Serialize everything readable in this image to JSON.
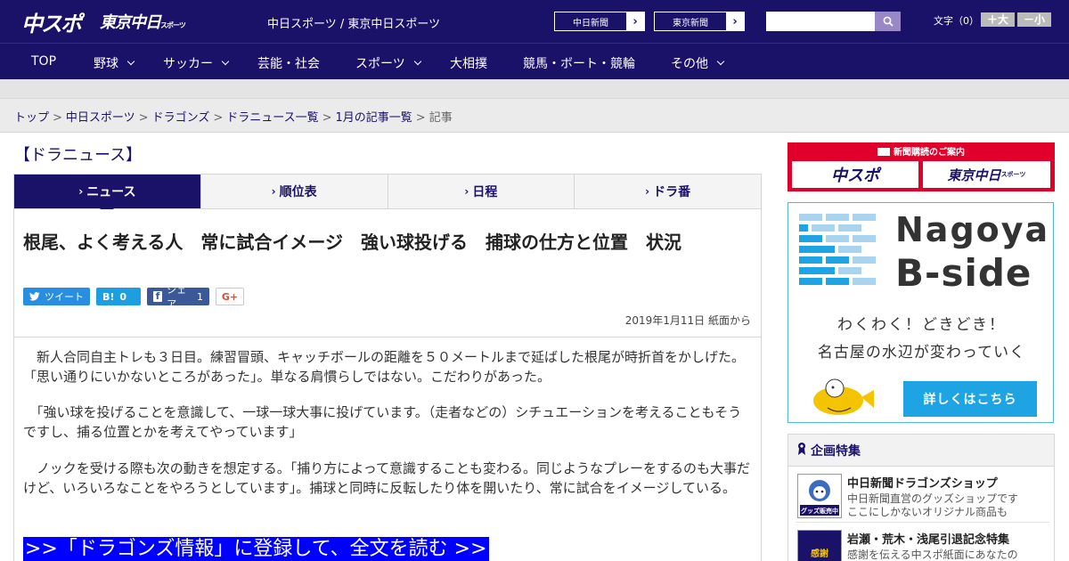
{
  "header": {
    "logo_left": "中スポ",
    "logo_right": "東京中日",
    "logo_right_small": "スポーツ",
    "site_title": "中日スポーツ / 東京中日スポーツ",
    "btn_chunichi": "中日新聞",
    "btn_tokyo": "東京新聞",
    "arrow": "›",
    "search_placeholder": "",
    "font_label": "文字（0）",
    "font_plus": "＋大",
    "font_minus": "－小"
  },
  "nav": [
    {
      "label": "TOP"
    },
    {
      "label": "野球"
    },
    {
      "label": "サッカー"
    },
    {
      "label": "芸能・社会"
    },
    {
      "label": "スポーツ"
    },
    {
      "label": "大相撲"
    },
    {
      "label": "競馬・ボート・競輪"
    },
    {
      "label": "その他"
    }
  ],
  "breadcrumb": {
    "items": [
      "トップ",
      "中日スポーツ",
      "ドラゴンズ",
      "ドラニュース一覧",
      "1月の記事一覧"
    ],
    "current": "記事",
    "sep": ">"
  },
  "section_title": "【ドラニュース】",
  "tabs": [
    {
      "label": "ニュース"
    },
    {
      "label": "順位表"
    },
    {
      "label": "日程"
    },
    {
      "label": "ドラ番"
    }
  ],
  "tab_marker": "›",
  "article": {
    "headline": "根尾、よく考える人　常に試合イメージ　強い球投げる　捕球の仕方と位置　状況",
    "share": {
      "tweet": "ツイート",
      "hatena_icon": "B!",
      "hatena_count": "0",
      "fb_label": "シェア",
      "fb_count": "1",
      "gplus": "G+"
    },
    "date": "2019年1月11日 紙面から",
    "paragraphs": [
      "　新人合同自主トレも３日目。練習冒頭、キャッチボールの距離を５０メートルまで延ばした根尾が時折首をかしげた。「思い通りにいかないところがあった」。単なる肩慣らしではない。こだわりがあった。",
      "　「強い球を投げることを意識して、一球一球大事に投げています。（走者などの）シチュエーションを考えることもそうですし、捕る位置とかを考えてやっています」",
      "　ノックを受ける際も次の動きを想定する。「捕り方によって意識することも変わる。同じようなプレーをするのも大事だけど、いろいろなことをやろうとしています」。捕球と同時に反転したり体を開いたり、常に試合をイメージしている。"
    ],
    "cta": ">>「ドラゴンズ情報」に登録して、全文を読む >>"
  },
  "sidebar": {
    "subscribe_header": "新聞購読のご案内",
    "subscribe_left": "中スポ",
    "subscribe_right": "東京中日",
    "subscribe_right_small": "スポーツ",
    "ad_title_1": "Nagoya",
    "ad_title_2": "B-side",
    "ad_text_1": "わくわく！どきどき！",
    "ad_text_2": "名古屋の水辺が変わっていく",
    "ad_button": "詳しくはこちら",
    "feature_header": "企画特集",
    "features": [
      {
        "title": "中日新聞ドラゴンズショップ",
        "desc1": "中日新聞直営のグッズショップです",
        "desc2": "ここにしかないオリジナル商品も",
        "thumb": "グッズ販売中"
      },
      {
        "title": "岩瀬・荒木・浅尾引退記念特集",
        "desc1": "感謝を伝える中スポ紙面にあなたの",
        "desc2": "",
        "thumb": "感謝"
      }
    ]
  },
  "colors": {
    "navy": "#1a1268",
    "accent": "#e0002a",
    "cyan": "#1ea4e3",
    "cta_blue": "#0000ff"
  }
}
